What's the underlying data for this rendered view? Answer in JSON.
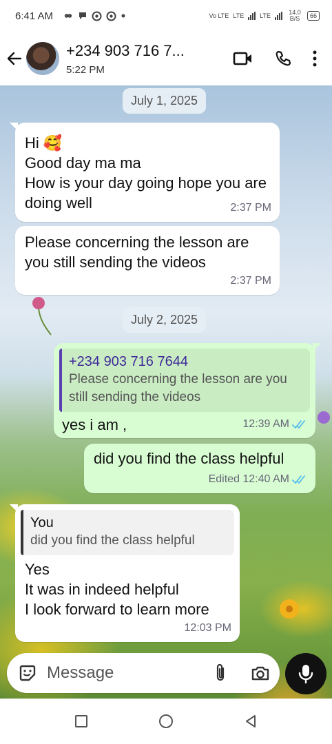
{
  "status_bar": {
    "time": "6:41 AM",
    "network_labels": [
      "Vo LTE",
      "LTE",
      "LTE"
    ],
    "data_speed": "14.0 B/S",
    "battery": "66"
  },
  "header": {
    "title": "+234 903 716 7...",
    "subtitle": "5:22 PM"
  },
  "chat": {
    "date_chips": [
      "July 1, 2025",
      "July 2, 2025"
    ],
    "messages": [
      {
        "direction": "incoming",
        "text": "Hi 🥰\nGood day ma ma\nHow is your day going hope you are doing well",
        "time": "2:37 PM"
      },
      {
        "direction": "incoming",
        "text": "Please concerning the lesson are you still sending the videos",
        "time": "2:37 PM"
      },
      {
        "direction": "outgoing",
        "quote_author": "+234 903 716 7644",
        "quote_text": "Please concerning the lesson are you still sending the videos",
        "text": "yes i am ,",
        "time": "12:39 AM",
        "status": "read"
      },
      {
        "direction": "outgoing",
        "text": "did you find the class helpful",
        "time": "Edited 12:40 AM",
        "status": "read"
      },
      {
        "direction": "incoming",
        "quote_author": "You",
        "quote_text": "did you find the class helpful",
        "text": "Yes\nIt was in indeed helpful\nI look forward to learn more",
        "time": "12:03 PM"
      }
    ]
  },
  "input": {
    "placeholder": "Message"
  },
  "colors": {
    "outgoing_bubble": "#d9fdd3",
    "incoming_bubble": "#ffffff",
    "read_tick": "#53bdeb",
    "quote_bar": "#5b3fb0"
  },
  "icons": {
    "back": "arrow-left-icon",
    "video": "video-call-icon",
    "phone": "phone-icon",
    "menu": "more-vertical-icon",
    "emoji": "sticker-icon",
    "attach": "paperclip-icon",
    "camera": "camera-icon",
    "mic": "microphone-icon"
  }
}
